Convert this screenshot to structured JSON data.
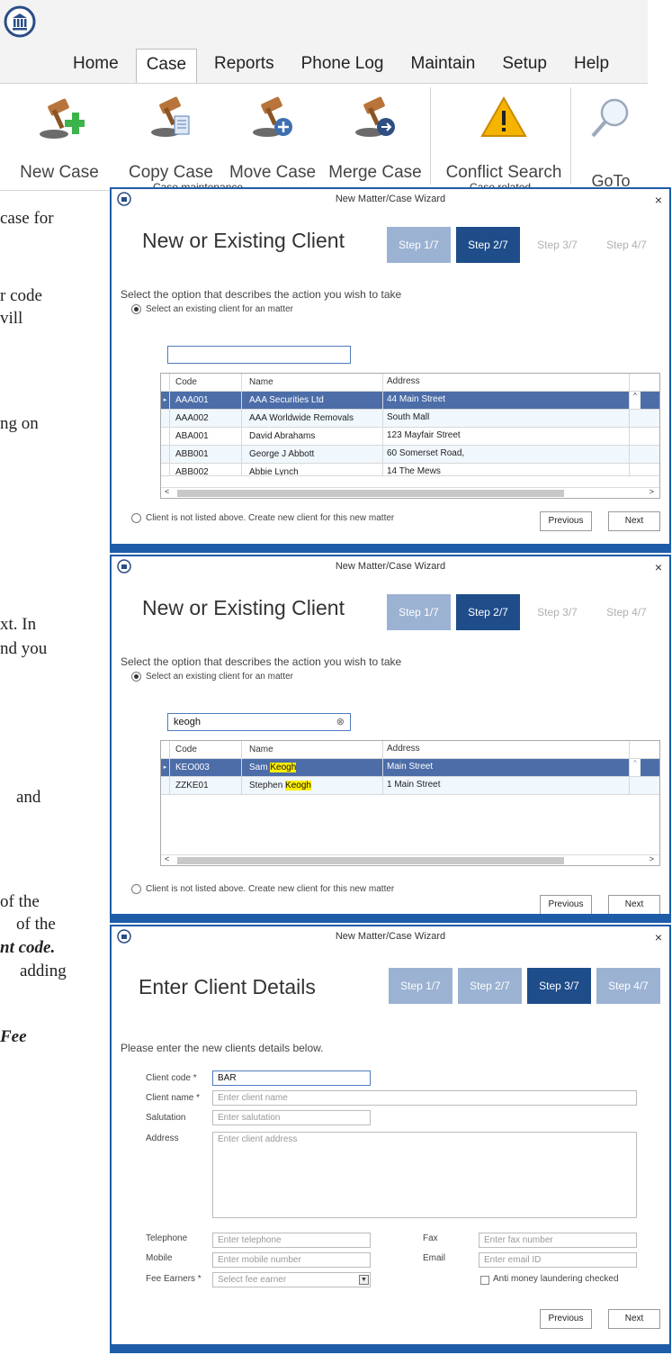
{
  "ribbon": {
    "menu": [
      "Home",
      "Case",
      "Reports",
      "Phone Log",
      "Maintain",
      "Setup",
      "Help"
    ],
    "active_menu": "Case",
    "buttons": {
      "new_case": "New Case",
      "copy_case": "Copy Case",
      "move_case": "Move Case",
      "merge_case": "Merge Case",
      "conflict_search": "Conflict Search",
      "goto": "GoTo"
    },
    "groups": {
      "maintenance": "Case maintenance",
      "related": "Case related"
    }
  },
  "background_text": [
    "case for",
    "r code",
    "vill",
    "ng on",
    "xt. In",
    "nd you",
    "and",
    "of the",
    "of the",
    "nt code.",
    "adding",
    "Fee"
  ],
  "wizard": {
    "title": "New Matter/Case Wizard",
    "close": "×",
    "step_labels": [
      "Step 1/7",
      "Step 2/7",
      "Step 3/7",
      "Step 4/7"
    ],
    "existing_heading": "New or Existing Client",
    "instruction": "Select the option that describes the action you wish to take",
    "radio_existing": "Select an existing client for an matter",
    "radio_new": "Client is not listed above. Create new client for this new matter",
    "columns": {
      "code": "Code",
      "name": "Name",
      "address": "Address"
    },
    "previous": "Previous",
    "next": "Next"
  },
  "window1": {
    "search_value": "",
    "rows": [
      {
        "code": "AAA001",
        "name": "AAA Securities Ltd",
        "address": "44 Main Street"
      },
      {
        "code": "AAA002",
        "name": "AAA Worldwide Removals",
        "address": "South Mall"
      },
      {
        "code": "ABA001",
        "name": "David Abrahams",
        "address": "123 Mayfair Street"
      },
      {
        "code": "ABB001",
        "name": "George J Abbott",
        "address": "60 Somerset Road,"
      },
      {
        "code": "ABB002",
        "name": "Abbie Lynch",
        "address": "14  The Mews"
      }
    ]
  },
  "window2": {
    "search_value": "keogh",
    "clear_icon": "⊗",
    "rows": [
      {
        "code": "KEO003",
        "first": "Sam ",
        "match": "Keogh",
        "address": "Main Street"
      },
      {
        "code": "ZZKE01",
        "first": "Stephen ",
        "match": "Keogh",
        "address": "1 Main Street"
      }
    ]
  },
  "window3": {
    "heading": "Enter Client Details",
    "instruction": "Please enter the new clients details below.",
    "labels": {
      "client_code": "Client code *",
      "client_name": "Client name *",
      "salutation": "Salutation",
      "address": "Address",
      "telephone": "Telephone",
      "fax": "Fax",
      "mobile": "Mobile",
      "email": "Email",
      "fee_earners": "Fee Earners *",
      "aml": "Anti money laundering checked"
    },
    "values": {
      "client_code": "BAR"
    },
    "placeholders": {
      "client_name": "Enter client name",
      "salutation": "Enter salutation",
      "address": "Enter client address",
      "telephone": "Enter telephone",
      "fax": "Enter fax number",
      "mobile": "Enter mobile number",
      "email": "Enter email ID",
      "fee_earners": "Select fee earner"
    }
  },
  "colors": {
    "accent": "#1f5ca8",
    "active_step": "#1e4d8a",
    "done_step": "#9bb2d2",
    "selected_row": "#4c6da8",
    "highlight": "#ffee00"
  }
}
